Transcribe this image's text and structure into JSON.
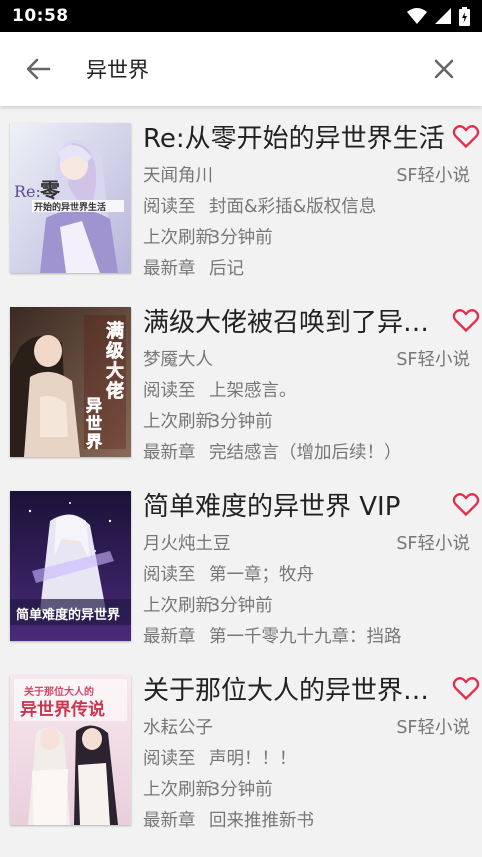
{
  "status_bar": {
    "time": "10:58"
  },
  "search": {
    "value": "异世界",
    "placeholder": ""
  },
  "colors": {
    "heart": "#e52e4d",
    "cursor": "#e91e63",
    "text_secondary": "#777777"
  },
  "icons": {
    "back": "arrow-left",
    "clear": "close",
    "favorite": "heart-outline"
  },
  "labels": {
    "read_to": "阅读至",
    "last_refresh": "上次刷新",
    "latest_chapter": "最新章"
  },
  "books": [
    {
      "title": "Re:从零开始的异世界生活",
      "author": "天闻角川",
      "source": "SF轻小说",
      "read_to": "封面&彩插&版权信息",
      "last_refresh": "3分钟前",
      "latest_chapter": "后记",
      "cover_text": "Re:从零 开始的异世界生活"
    },
    {
      "title": "满级大佬被召唤到了异世界",
      "author": "梦魇大人",
      "source": "SF轻小说",
      "read_to": "上架感言。",
      "last_refresh": "3分钟前",
      "latest_chapter": "完结感言（增加后续！）",
      "cover_text": "满级大佬被召唤到了异世界"
    },
    {
      "title": "简单难度的异世界 VIP",
      "author": "月火炖土豆",
      "source": "SF轻小说",
      "read_to": "第一章；牧舟",
      "last_refresh": "3分钟前",
      "latest_chapter": "第一千零九十九章：挡路",
      "cover_text": "简单难度的异世界"
    },
    {
      "title": "关于那位大人的异世界传说",
      "author": "水耘公子",
      "source": "SF轻小说",
      "read_to": "声明！！！",
      "last_refresh": "3分钟前",
      "latest_chapter": "回来推推新书",
      "cover_text": "关于那位大人的 异世界传说"
    }
  ]
}
